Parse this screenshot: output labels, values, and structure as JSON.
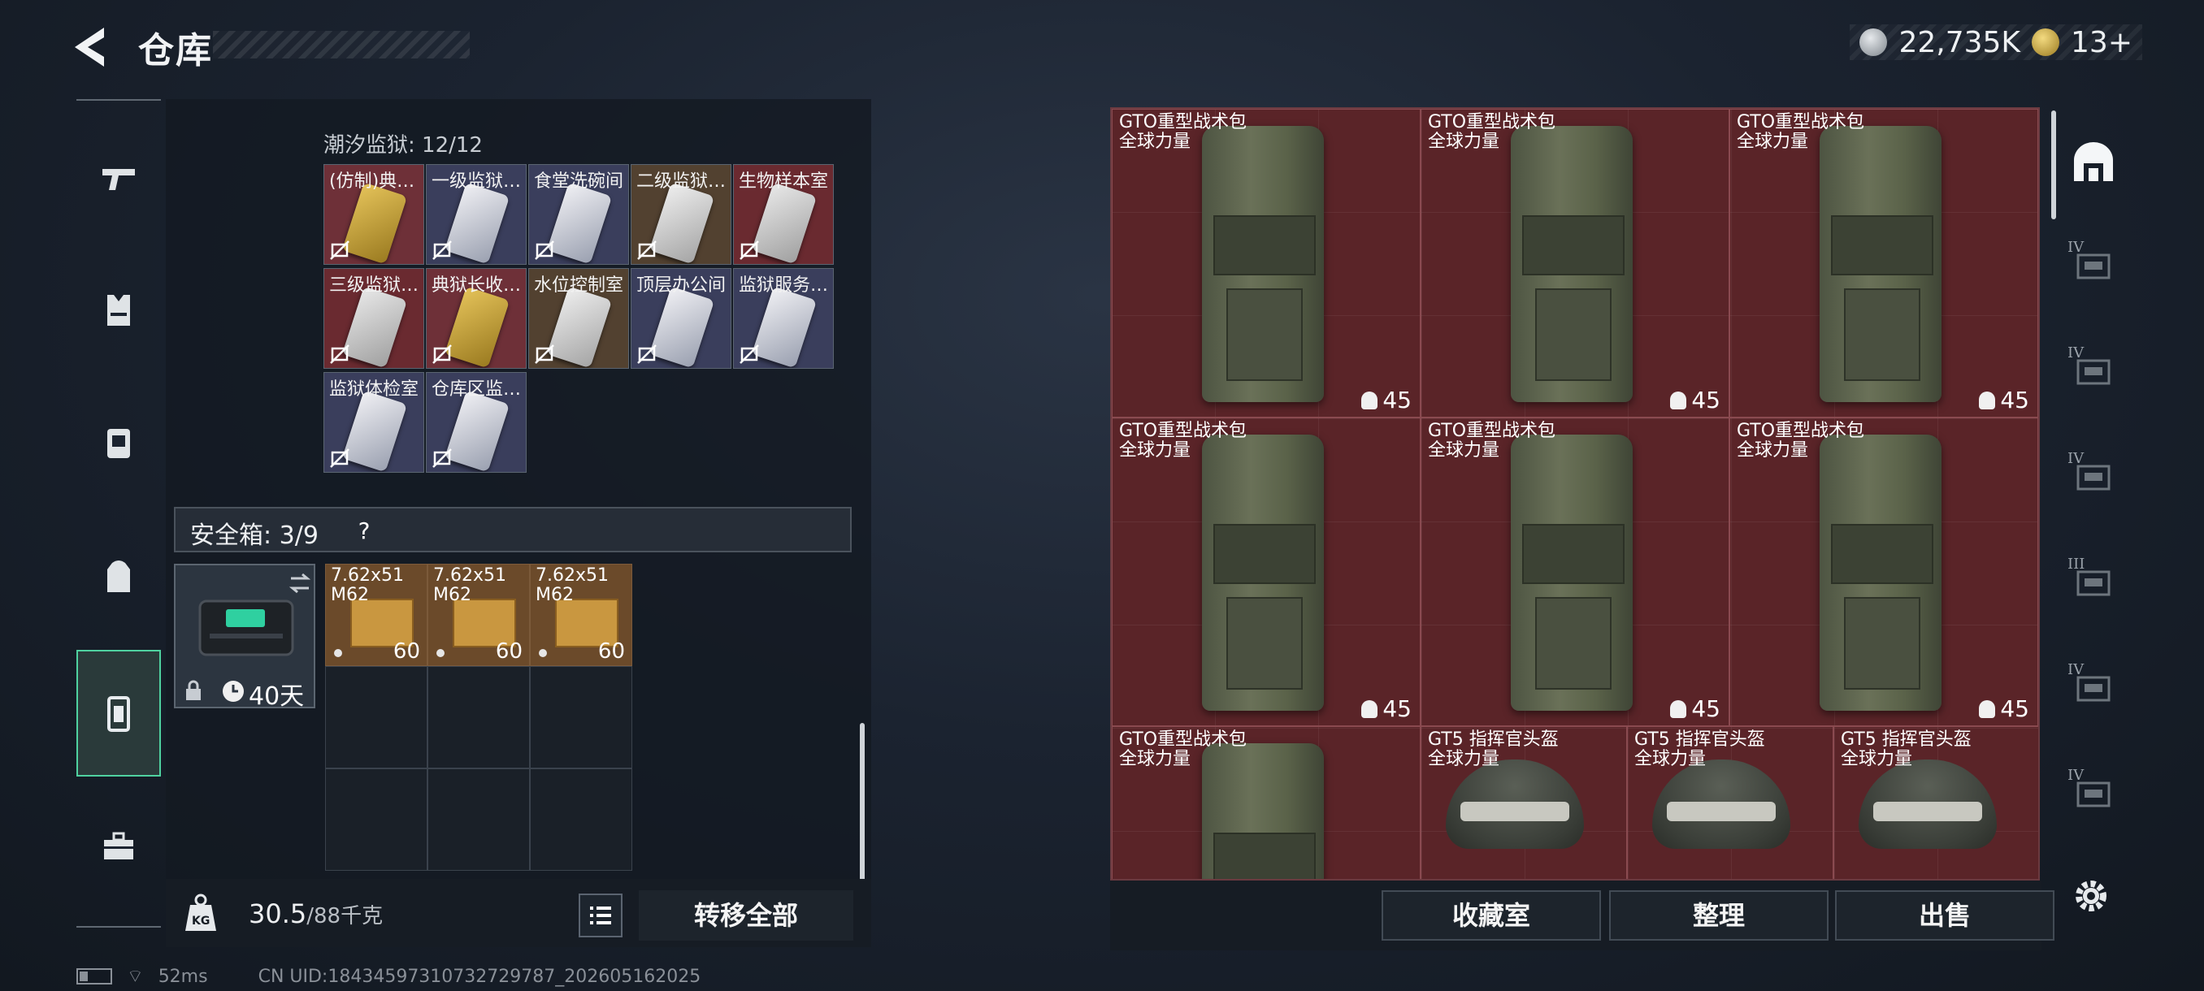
{
  "header": {
    "title": "仓库",
    "currency": [
      {
        "icon": "silver-coin-icon",
        "value": "22,735K",
        "color": "#b9bfc6"
      },
      {
        "icon": "gold-triangle-icon",
        "value": "13+",
        "color": "#d8b64a"
      }
    ]
  },
  "left_nav": {
    "items": [
      {
        "icon": "weapon-icon"
      },
      {
        "icon": "armor-vest-icon"
      },
      {
        "icon": "chest-rig-icon"
      },
      {
        "icon": "backpack-icon"
      },
      {
        "icon": "safe-box-icon",
        "active": true
      },
      {
        "icon": "toolbox-icon"
      }
    ]
  },
  "keycards": {
    "label": "潮汐监狱: 12/12",
    "items": [
      {
        "name": "(仿制)典…",
        "bg": "gold"
      },
      {
        "name": "一级监狱…",
        "bg": "blue"
      },
      {
        "name": "食堂洗碗间",
        "bg": "blue"
      },
      {
        "name": "二级监狱…",
        "bg": "brown"
      },
      {
        "name": "生物样本室",
        "bg": "red"
      },
      {
        "name": "三级监狱…",
        "bg": "red"
      },
      {
        "name": "典狱长收…",
        "bg": "gold"
      },
      {
        "name": "水位控制室",
        "bg": "brown"
      },
      {
        "name": "顶层办公间",
        "bg": "blue"
      },
      {
        "name": "监狱服务…",
        "bg": "blue"
      },
      {
        "name": "监狱体检室",
        "bg": "blue"
      },
      {
        "name": "仓库区监…",
        "bg": "blue"
      }
    ]
  },
  "safe_box": {
    "label": "安全箱: 3/9",
    "help": "?",
    "duration": "40天",
    "ammo": [
      {
        "name_line1": "7.62x51",
        "name_line2": "M62",
        "count": "60"
      },
      {
        "name_line1": "7.62x51",
        "name_line2": "M62",
        "count": "60"
      },
      {
        "name_line1": "7.62x51",
        "name_line2": "M62",
        "count": "60"
      }
    ]
  },
  "bottom_left": {
    "weight_value": "30.5",
    "weight_max": "/88千克",
    "transfer_label": "转移全部"
  },
  "grid_items": [
    {
      "name": "GTO重型战术包",
      "sub": "全球力量",
      "durability": "45",
      "kind": "backpack"
    },
    {
      "name": "GTO重型战术包",
      "sub": "全球力量",
      "durability": "45",
      "kind": "backpack"
    },
    {
      "name": "GTO重型战术包",
      "sub": "全球力量",
      "durability": "45",
      "kind": "backpack"
    },
    {
      "name": "GTO重型战术包",
      "sub": "全球力量",
      "durability": "45",
      "kind": "backpack"
    },
    {
      "name": "GTO重型战术包",
      "sub": "全球力量",
      "durability": "45",
      "kind": "backpack"
    },
    {
      "name": "GTO重型战术包",
      "sub": "全球力量",
      "durability": "45",
      "kind": "backpack"
    },
    {
      "name": "GTO重型战术包",
      "sub": "全球力量",
      "kind": "backpack"
    },
    {
      "name": "GT5 指挥官头盔",
      "sub": "全球力量",
      "kind": "helmet"
    },
    {
      "name": "GT5 指挥官头盔",
      "sub": "全球力量",
      "kind": "helmet"
    },
    {
      "name": "GT5 指挥官头盔",
      "sub": "全球力量",
      "kind": "helmet"
    }
  ],
  "right_nav": {
    "items": [
      {
        "icon": "arch-storage-icon",
        "level": ""
      },
      {
        "icon": "storage-rack-icon",
        "level": "IV"
      },
      {
        "icon": "medical-kit-icon",
        "level": "IV"
      },
      {
        "icon": "folder-storage-icon",
        "level": "IV"
      },
      {
        "icon": "weapon-rack-icon",
        "level": "III"
      },
      {
        "icon": "storage-rack-icon",
        "level": "IV"
      },
      {
        "icon": "warning-crate-icon",
        "level": "IV"
      }
    ]
  },
  "bottom_right": {
    "collection_label": "收藏室",
    "sort_label": "整理",
    "sell_label": "出售"
  },
  "status": {
    "ping": "52ms",
    "uid": "CN UID:18434597310732729787_202605162025"
  }
}
